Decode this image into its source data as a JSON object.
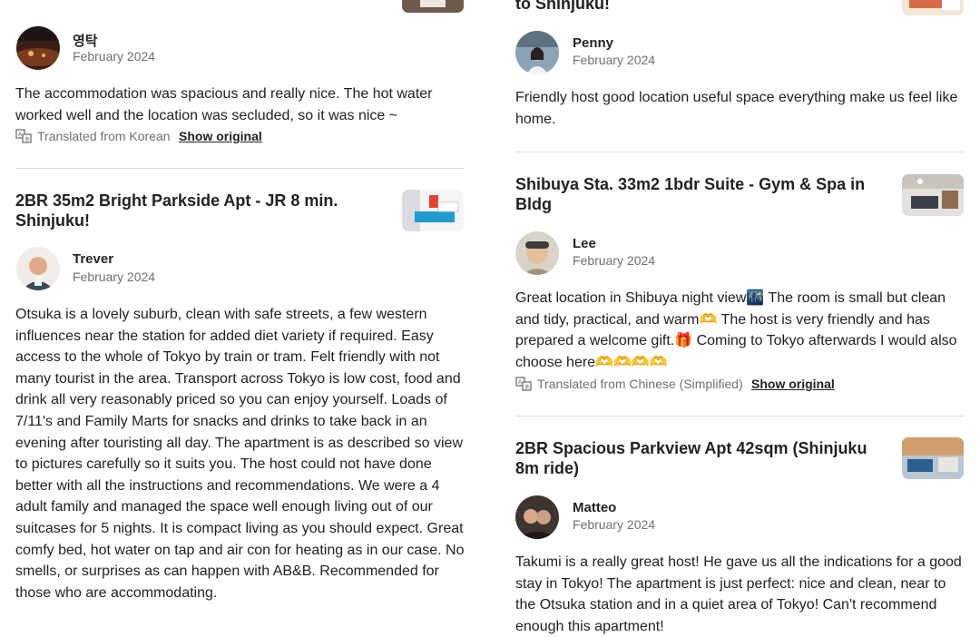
{
  "left_column": {
    "top_partial_review": {
      "reviewer": "영탁",
      "date": "February 2024",
      "text": "The accommodation was spacious and really nice. The hot water worked well and the location was secluded, so it was nice ~",
      "translated_label": "Translated from Korean",
      "show_original_label": "Show original"
    },
    "listing_1": {
      "title": "2BR 35m2 Bright Parkside Apt - JR 8 min. Shinjuku!",
      "review": {
        "reviewer": "Trever",
        "date": "February 2024",
        "text": "Otsuka is a lovely suburb, clean with safe streets, a few western influences near the station for added diet variety if required. Easy access to the whole of Tokyo by train or tram. Felt friendly with not many tourist in the area. Transport across Tokyo is low cost, food and drink all very reasonably priced so you can enjoy yourself. Loads of 7/11's and Family Marts for snacks and drinks to take back in an evening after touristing all day. The apartment is as described so view to pictures carefully so it suits you. The host could not have done better with all the instructions and recommendations. We were a 4 adult family and managed the space well enough living out of our suitcases for 5 nights. It is compact living as you should expect. Great comfy bed, hot water on tap and air con for heating as in our case. No smells, or surprises as can happen with AB&B. Recommended for those who are accommodating."
      }
    }
  },
  "right_column": {
    "top_partial_title": "to Shinjuku!",
    "top_partial_review": {
      "reviewer": "Penny",
      "date": "February 2024",
      "text": "Friendly host good location useful space everything make us feel like home."
    },
    "listing_2": {
      "title": "Shibuya Sta. 33m2 1bdr Suite - Gym & Spa in Bldg",
      "review": {
        "reviewer": "Lee",
        "date": "February 2024",
        "text": "Great location in Shibuya night view🌃 The room is small but clean and tidy, practical, and warm🫶 The host is very friendly and has prepared a welcome gift.🎁 Coming to Tokyo afterwards I would also choose here🫶🫶🫶🫶",
        "translated_label": "Translated from Chinese (Simplified)",
        "show_original_label": "Show original"
      }
    },
    "listing_3": {
      "title": "2BR Spacious Parkview Apt 42sqm (Shinjuku 8m ride)",
      "review": {
        "reviewer": "Matteo",
        "date": "February 2024",
        "text": "Takumi is a really great host! He gave us all the indications for a good stay in Tokyo! The apartment is just perfect: nice and clean, near to the Otsuka station and in a quiet area of Tokyo! Can't recommend enough this apartment!"
      }
    }
  },
  "icons": {
    "translate": "translate-icon"
  }
}
